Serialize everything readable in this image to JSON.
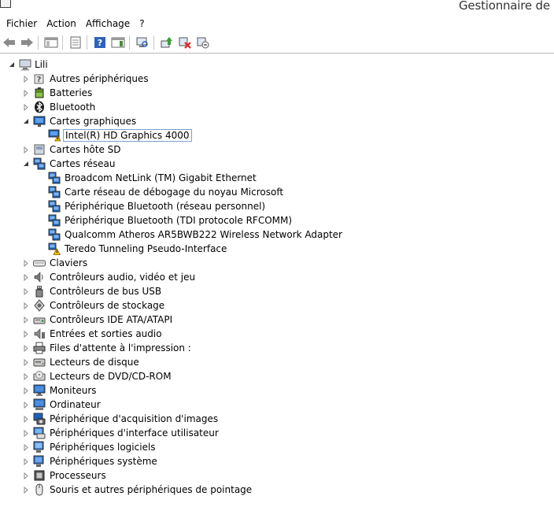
{
  "window": {
    "title": "Gestionnaire de pé"
  },
  "menu": {
    "items": [
      "Fichier",
      "Action",
      "Affichage",
      "?"
    ]
  },
  "toolbar": {
    "buttons": [
      "back-icon",
      "forward-icon",
      "console-tree-icon",
      "properties-icon",
      "help-icon",
      "action-pane-icon",
      "scan-hardware-icon",
      "update-driver-icon",
      "disable-device-icon",
      "uninstall-device-icon"
    ]
  },
  "tree": {
    "root": "Lili",
    "items": [
      {
        "label": "Autres périphériques",
        "icon": "unknown-device-icon",
        "level": 1,
        "state": "collapsed"
      },
      {
        "label": "Batteries",
        "icon": "battery-icon",
        "level": 1,
        "state": "collapsed"
      },
      {
        "label": "Bluetooth",
        "icon": "bluetooth-icon",
        "level": 1,
        "state": "collapsed"
      },
      {
        "label": "Cartes graphiques",
        "icon": "display-adapter-icon",
        "level": 1,
        "state": "expanded"
      },
      {
        "label": "Intel(R) HD Graphics 4000",
        "icon": "display-adapter-warning-icon",
        "level": 2,
        "state": "leaf",
        "selected": true
      },
      {
        "label": "Cartes hôte SD",
        "icon": "sd-host-icon",
        "level": 1,
        "state": "collapsed"
      },
      {
        "label": "Cartes réseau",
        "icon": "network-adapter-icon",
        "level": 1,
        "state": "expanded"
      },
      {
        "label": "Broadcom NetLink (TM) Gigabit Ethernet",
        "icon": "network-adapter-icon",
        "level": 2,
        "state": "leaf"
      },
      {
        "label": "Carte réseau de débogage du noyau Microsoft",
        "icon": "network-adapter-icon",
        "level": 2,
        "state": "leaf"
      },
      {
        "label": "Périphérique Bluetooth (réseau personnel)",
        "icon": "network-adapter-icon",
        "level": 2,
        "state": "leaf"
      },
      {
        "label": "Périphérique Bluetooth (TDI protocole RFCOMM)",
        "icon": "network-adapter-icon",
        "level": 2,
        "state": "leaf"
      },
      {
        "label": "Qualcomm Atheros AR5BWB222 Wireless Network Adapter",
        "icon": "network-adapter-icon",
        "level": 2,
        "state": "leaf"
      },
      {
        "label": "Teredo Tunneling Pseudo-Interface",
        "icon": "network-adapter-warning-icon",
        "level": 2,
        "state": "leaf"
      },
      {
        "label": "Claviers",
        "icon": "keyboard-icon",
        "level": 1,
        "state": "collapsed"
      },
      {
        "label": "Contrôleurs audio, vidéo et jeu",
        "icon": "speaker-icon",
        "level": 1,
        "state": "collapsed"
      },
      {
        "label": "Contrôleurs de bus USB",
        "icon": "usb-icon",
        "level": 1,
        "state": "collapsed"
      },
      {
        "label": "Contrôleurs de stockage",
        "icon": "storage-controller-icon",
        "level": 1,
        "state": "collapsed"
      },
      {
        "label": "Contrôleurs IDE ATA/ATAPI",
        "icon": "ide-controller-icon",
        "level": 1,
        "state": "collapsed"
      },
      {
        "label": "Entrées et sorties audio",
        "icon": "audio-io-icon",
        "level": 1,
        "state": "collapsed"
      },
      {
        "label": "Files d'attente à l'impression :",
        "icon": "printer-icon",
        "level": 1,
        "state": "collapsed"
      },
      {
        "label": "Lecteurs de disque",
        "icon": "disk-drive-icon",
        "level": 1,
        "state": "collapsed"
      },
      {
        "label": "Lecteurs de DVD/CD-ROM",
        "icon": "dvd-drive-icon",
        "level": 1,
        "state": "collapsed"
      },
      {
        "label": "Moniteurs",
        "icon": "monitor-icon",
        "level": 1,
        "state": "collapsed"
      },
      {
        "label": "Ordinateur",
        "icon": "computer-icon",
        "level": 1,
        "state": "collapsed"
      },
      {
        "label": "Périphérique d'acquisition d'images",
        "icon": "camera-icon",
        "level": 1,
        "state": "collapsed"
      },
      {
        "label": "Périphériques d'interface utilisateur",
        "icon": "hid-icon",
        "level": 1,
        "state": "collapsed"
      },
      {
        "label": "Périphériques logiciels",
        "icon": "software-device-icon",
        "level": 1,
        "state": "collapsed"
      },
      {
        "label": "Périphériques système",
        "icon": "system-device-icon",
        "level": 1,
        "state": "collapsed"
      },
      {
        "label": "Processeurs",
        "icon": "processor-icon",
        "level": 1,
        "state": "collapsed"
      },
      {
        "label": "Souris et autres périphériques de pointage",
        "icon": "mouse-icon",
        "level": 1,
        "state": "collapsed"
      }
    ]
  },
  "colors": {
    "selection_border": "#7da2ce",
    "toolbar_border": "#b9b9b9",
    "warning": "#f2c200",
    "monitor_blue": "#1f5fb5"
  }
}
